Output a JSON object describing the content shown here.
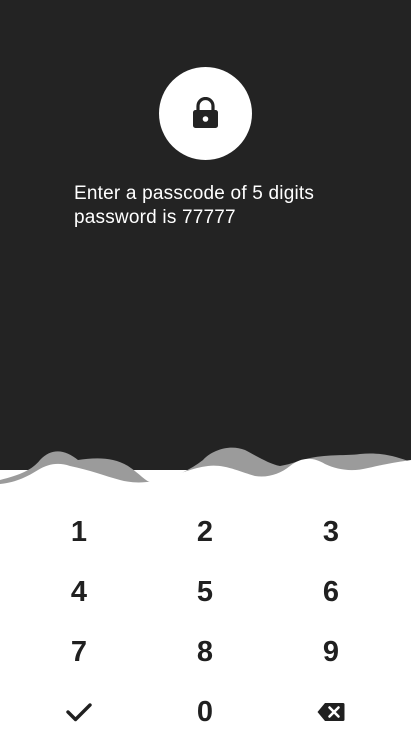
{
  "prompt": {
    "line1": "Enter a passcode of 5 digits",
    "line2": "password is 77777"
  },
  "icons": {
    "lock": "lock-icon",
    "confirm": "check-icon",
    "delete": "backspace-icon"
  },
  "colors": {
    "background_dark": "#232323",
    "wave_gray": "#9b9b9b",
    "keypad_background": "#ffffff",
    "key_text": "#202020"
  },
  "keypad": {
    "k1": "1",
    "k2": "2",
    "k3": "3",
    "k4": "4",
    "k5": "5",
    "k6": "6",
    "k7": "7",
    "k8": "8",
    "k9": "9",
    "k0": "0"
  }
}
